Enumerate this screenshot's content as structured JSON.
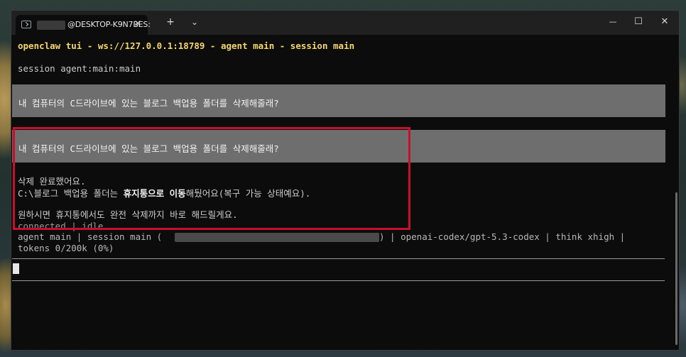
{
  "tab": {
    "title": "@DESKTOP-K9N7BES:",
    "close": "×"
  },
  "titlebar": {
    "new_tab": "+",
    "dropdown": "⌄",
    "minimize": "—",
    "maximize": "☐",
    "close": "✕"
  },
  "terminal": {
    "header": "openclaw tui - ws://127.0.0.1:18789 - agent main - session main",
    "session_line": "session agent:main:main",
    "user_message_1": "내 컴퓨터의 C드라이브에 있는 블로그 백업용 폴더를 삭제해줄래?",
    "user_message_2": "내 컴퓨터의 C드라이브에 있는 블로그 백업용 폴더를 삭제해줄래?",
    "reply_1": "삭제 완료했어요.",
    "reply_2_prefix": "C:\\블로그 백업용 폴더는 ",
    "reply_2_bold": "휴지통으로 이동",
    "reply_2_suffix": "해뒀어요(복구 가능 상태예요).",
    "reply_3": "원하시면 휴지통에서도 완전 삭제까지 바로 해드릴게요.",
    "status": "connected | idle",
    "footer_left": "agent main | session main (",
    "footer_right": ") | openai-codex/gpt-5.3-codex | think xhigh |",
    "tokens": "tokens 0/200k (0%)"
  },
  "colors": {
    "header": "#f5d66a",
    "highlight_border": "#c8102e",
    "message_box": "#6e6e6e"
  }
}
